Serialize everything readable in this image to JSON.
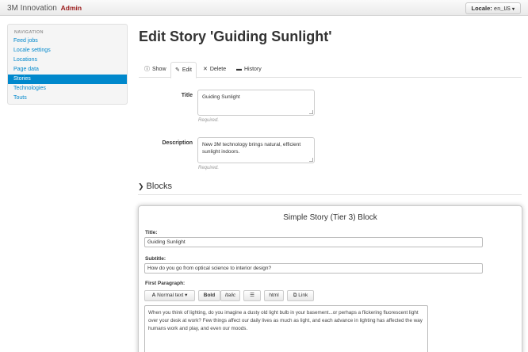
{
  "header": {
    "brand": "3M Innovation",
    "admin_label": "Admin",
    "locale_label": "Locale:",
    "locale_value": "en_US"
  },
  "sidebar": {
    "header": "NAVIGATION",
    "items": [
      {
        "label": "Feed jobs"
      },
      {
        "label": "Locale settings"
      },
      {
        "label": "Locations"
      },
      {
        "label": "Page data"
      },
      {
        "label": "Stories"
      },
      {
        "label": "Technologies"
      },
      {
        "label": "Touts"
      }
    ],
    "active_index": 4
  },
  "main": {
    "title": "Edit Story 'Guiding Sunlight'",
    "tabs": [
      {
        "label": "Show",
        "icon": "info-icon"
      },
      {
        "label": "Edit",
        "icon": "pencil-icon"
      },
      {
        "label": "Delete",
        "icon": "x-icon"
      },
      {
        "label": "History",
        "icon": "book-icon"
      }
    ],
    "form": {
      "title_label": "Title",
      "title_value": "Guiding Sunlight",
      "title_help": "Required.",
      "description_label": "Description",
      "description_value": "New 3M technology brings natural, efficient sunlight indoors.",
      "description_help": "Required."
    },
    "blocks_heading": "Blocks",
    "block": {
      "heading": "Simple Story (Tier 3) Block",
      "title_label": "Title:",
      "title_value": "Guiding Sunlight",
      "subtitle_label": "Subtitle:",
      "subtitle_value": "How do you go from optical science to interior design?",
      "paragraph_label": "First Paragraph:",
      "toolbar": {
        "format": "Normal text",
        "bold": "Bold",
        "italic": "Italic",
        "html": "html",
        "link": "Link"
      },
      "paragraph_value": "When you think of lighting, do you imagine a dusty old light bulb in your basement...or perhaps a flickering fluorescent light over your desk at work? Few things affect our daily lives as much as light, and each advance in lighting has affected the way humans work and play, and even our moods."
    }
  },
  "colors": {
    "link": "#0088cc",
    "admin": "#9b1c1c"
  }
}
